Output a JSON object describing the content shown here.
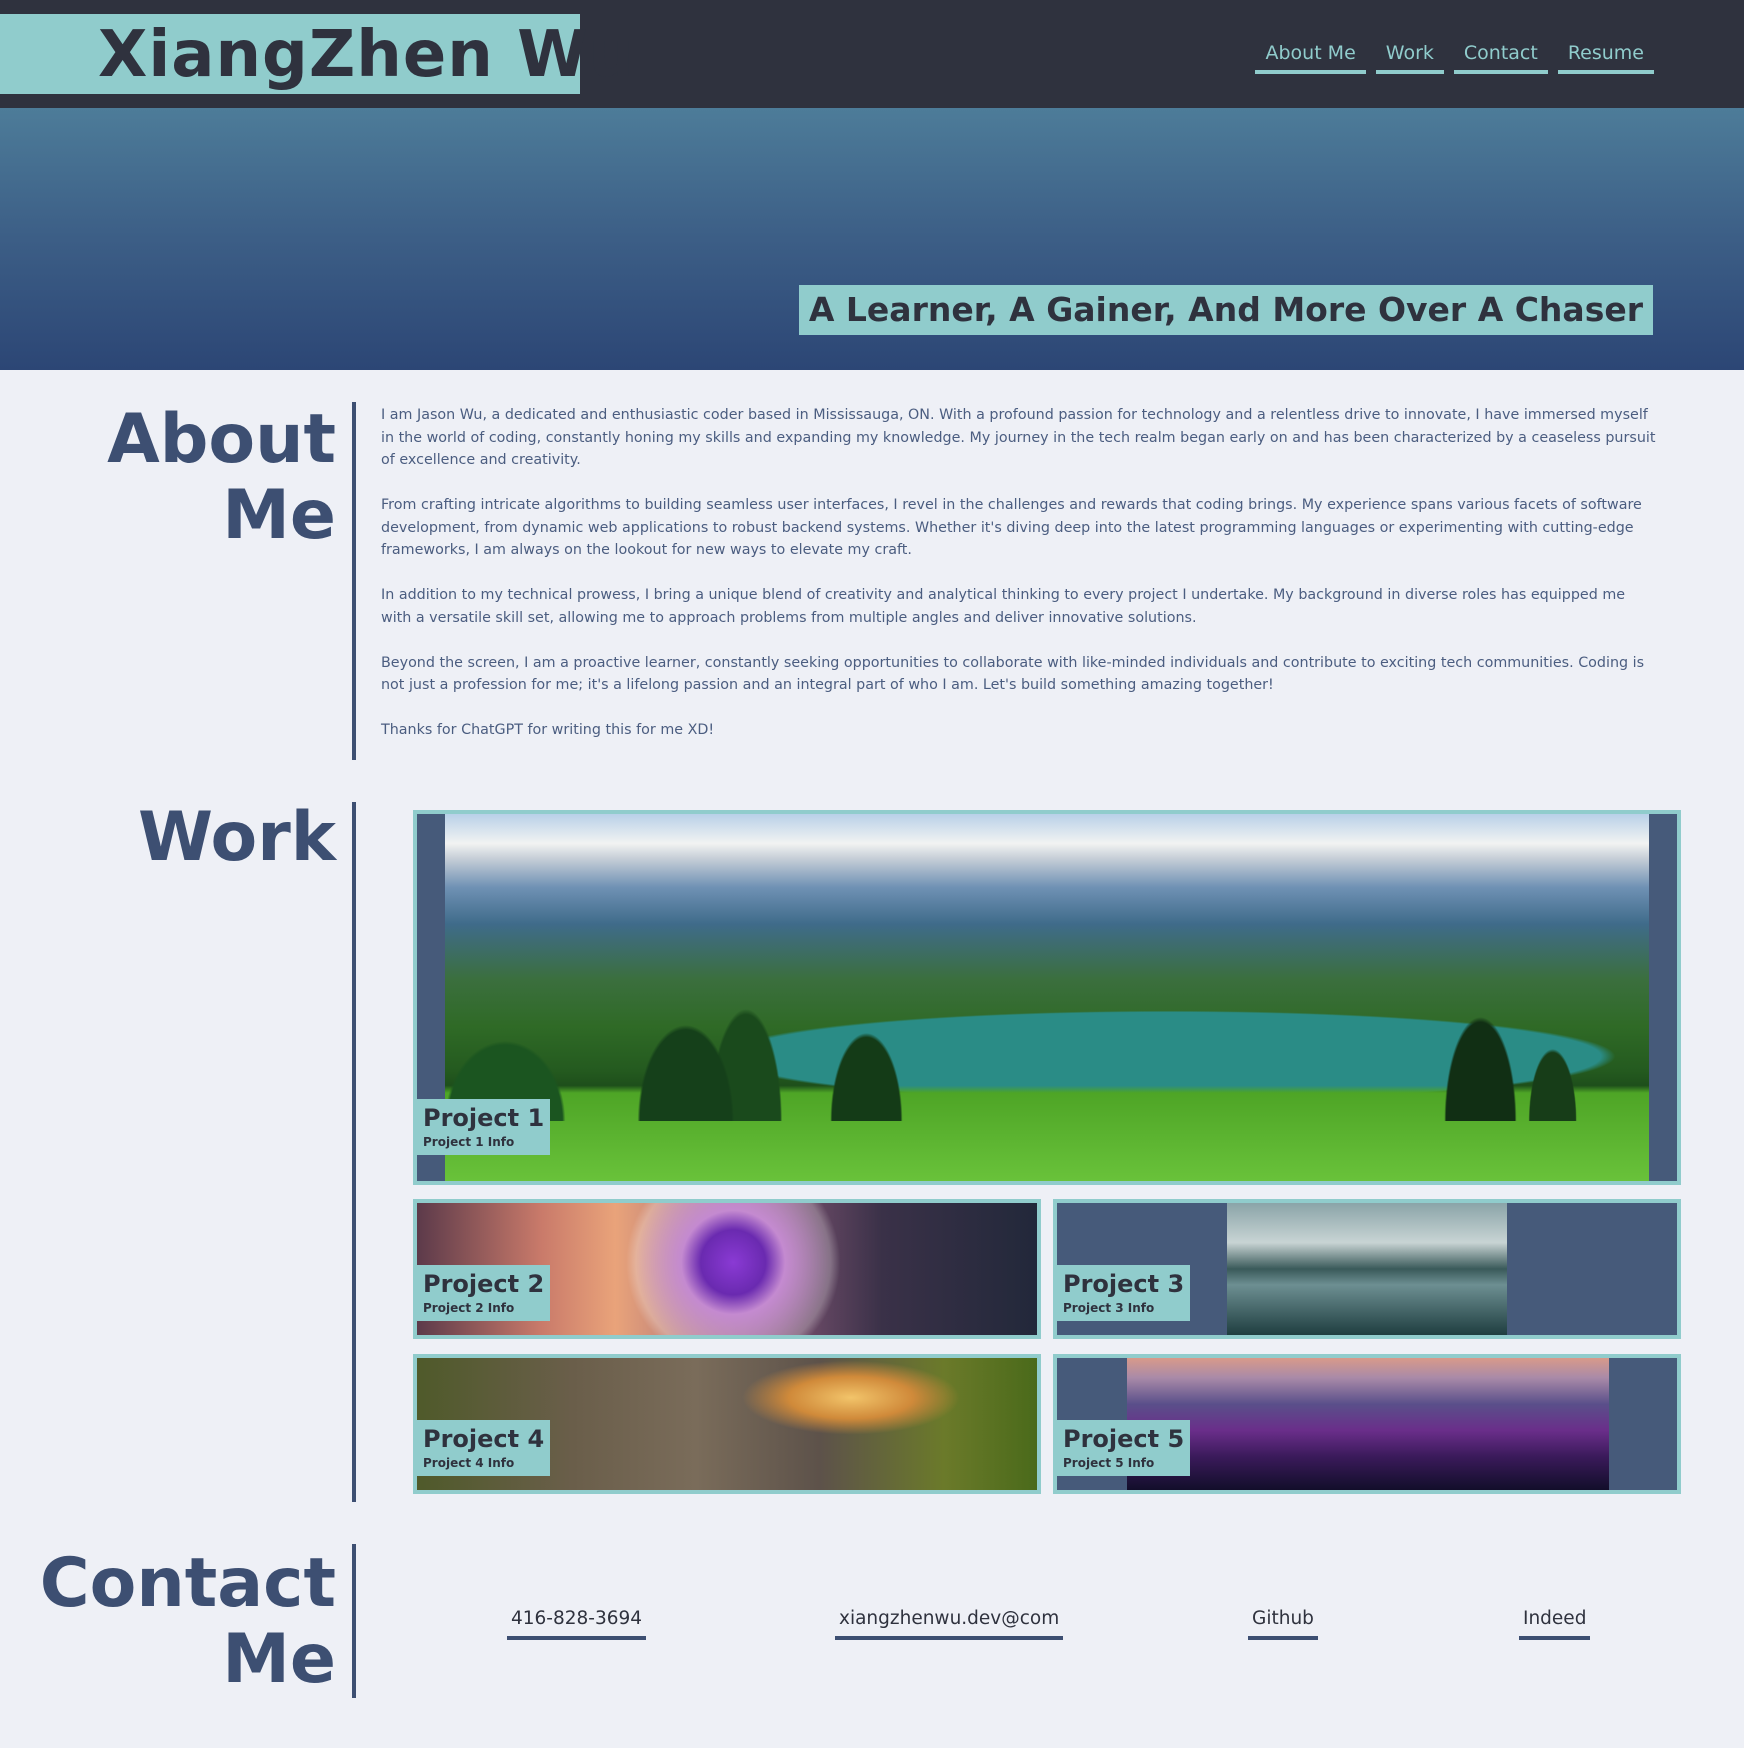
{
  "header": {
    "name": "XiangZhen Wu",
    "nav": [
      "About Me",
      "Work",
      "Contact",
      "Resume"
    ]
  },
  "hero": {
    "tagline": "A Learner, A Gainer, And More Over A Chaser"
  },
  "about": {
    "title_line1": "About",
    "title_line2": "Me",
    "paragraphs": [
      "I am Jason Wu, a dedicated and enthusiastic coder based in Mississauga, ON. With a profound passion for technology and a relentless drive to innovate, I have immersed myself in the world of coding, constantly honing my skills and expanding my knowledge. My journey in the tech realm began early on and has been characterized by a ceaseless pursuit of excellence and creativity.",
      "From crafting intricate algorithms to building seamless user interfaces, I revel in the challenges and rewards that coding brings. My experience spans various facets of software development, from dynamic web applications to robust backend systems. Whether it's diving deep into the latest programming languages or experimenting with cutting-edge frameworks, I am always on the lookout for new ways to elevate my craft.",
      "In addition to my technical prowess, I bring a unique blend of creativity and analytical thinking to every project I undertake. My background in diverse roles has equipped me with a versatile skill set, allowing me to approach problems from multiple angles and deliver innovative solutions.",
      "Beyond the screen, I am a proactive learner, constantly seeking opportunities to collaborate with like-minded individuals and contribute to exciting tech communities. Coding is not just a profession for me; it's a lifelong passion and an integral part of who I am. Let's build something amazing together!",
      "Thanks for ChatGPT for writing this for me XD!"
    ]
  },
  "work": {
    "title": "Work",
    "projects": [
      {
        "title": "Project 1",
        "info": "Project 1 Info"
      },
      {
        "title": "Project 2",
        "info": "Project 2 Info"
      },
      {
        "title": "Project 3",
        "info": "Project 3 Info"
      },
      {
        "title": "Project 4",
        "info": "Project 4 Info"
      },
      {
        "title": "Project 5",
        "info": "Project 5 Info"
      }
    ]
  },
  "contact": {
    "title_line1": "Contact",
    "title_line2": "Me",
    "phone": "416-828-3694",
    "email": "xiangzhenwu.dev@com",
    "github": "Github",
    "indeed": "Indeed"
  },
  "colors": {
    "header_bg": "#2f323e",
    "accent": "#90cccc",
    "heading": "#3d4f72",
    "page_bg": "#eef0f6"
  }
}
